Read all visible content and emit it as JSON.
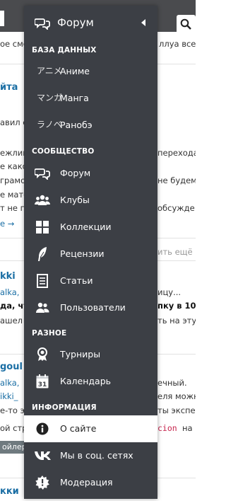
{
  "background": {
    "lines": [
      "ое сме",
      "ллуа все",
      "йта",
      "авил с",
      "ежлив",
      "е како",
      "грамот",
      "е мате",
      "т не по",
      "е →",
      "переходам",
      "не будем",
      "обсужде",
      "ить ещё",
      "kki",
      "alka,",
      "ицу...",
      "да, что",
      "пку в 10",
      "ашел",
      "ть на эту",
      "goul",
      "alka,",
      "ечный.",
      "ikki_",
      "еля можн",
      "е-то э",
      "ты экспе",
      "ой стр",
      "cion",
      "на",
      "кки",
      "ойлер"
    ]
  },
  "menu": {
    "header": {
      "label": "Форум",
      "icon": "chat-bubbles-icon"
    },
    "sections": [
      {
        "title": "БАЗА ДАННЫХ",
        "items": [
          {
            "kana": "アニメ",
            "label": "Аниме"
          },
          {
            "kana": "マンガ",
            "label": "Манга"
          },
          {
            "kana": "ラノベ",
            "label": "Ранобэ"
          }
        ]
      },
      {
        "title": "СООБЩЕСТВО",
        "items": [
          {
            "icon": "chat-bubbles-icon",
            "label": "Форум"
          },
          {
            "icon": "users-group-icon",
            "label": "Клубы"
          },
          {
            "icon": "grid-icon",
            "label": "Коллекции"
          },
          {
            "icon": "feather-icon",
            "label": "Рецензии"
          },
          {
            "icon": "document-icon",
            "label": "Статьи"
          },
          {
            "icon": "users-icon",
            "label": "Пользователи"
          }
        ]
      },
      {
        "title": "РАЗНОЕ",
        "items": [
          {
            "icon": "award-icon",
            "label": "Турниры"
          },
          {
            "icon": "calendar-icon",
            "label": "Календарь",
            "calendar_day": "31"
          }
        ]
      },
      {
        "title": "ИНФОРМАЦИЯ",
        "items": [
          {
            "icon": "info-icon",
            "label": "О сайте",
            "active": true
          },
          {
            "icon": "vk-icon",
            "label": "Мы в соц. сетях"
          },
          {
            "icon": "moderation-gear-icon",
            "label": "Модерация"
          }
        ]
      }
    ]
  },
  "colors": {
    "menu_bg": "#3c3f45",
    "active_bg": "#ffffff",
    "link": "#1a6ea4"
  }
}
